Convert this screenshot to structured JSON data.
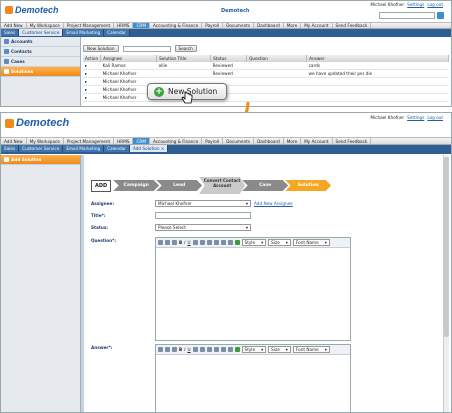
{
  "shot1": {
    "logo": "Demotech",
    "header_center": "Demotech",
    "user_links": [
      "Michael Khofner",
      "Settings",
      "Log out"
    ],
    "search_button": "Search",
    "nav": [
      "Add New",
      "My Workspace",
      "Project Management",
      "HRMS",
      "CRM",
      "Accounting & Finance",
      "Payroll",
      "Documents",
      "Dashboard",
      "More",
      "My Account",
      "Send Feedback"
    ],
    "tabs": [
      "Sales",
      "Customer Service",
      "Email Marketing",
      "Calendar"
    ],
    "sidebar": [
      "Accounts",
      "Contacts",
      "Cases",
      "Solutions"
    ],
    "toolbar": {
      "new_button": "New Solution",
      "search_button": "Search"
    },
    "table": {
      "headers": [
        "Action",
        "Assignee",
        "Solution Title",
        "Status",
        "Question",
        "Answer"
      ],
      "rows": [
        [
          "Kali Ramos",
          "ollie",
          "Reviewed",
          "",
          "cards"
        ],
        [
          "Michael Khofner",
          "",
          "Reviewed",
          "",
          "we have updated their per die"
        ],
        [
          "Michael Khofner",
          "",
          "",
          "",
          ""
        ],
        [
          "Michael Khofner",
          "",
          "",
          "",
          ""
        ],
        [
          "Michael Khofner",
          "",
          "",
          "",
          ""
        ]
      ]
    },
    "callout_label": "New Solution"
  },
  "shot2": {
    "logo": "Demotech",
    "user_links": [
      "Michael Khofner",
      "Settings",
      "Log out"
    ],
    "nav": [
      "Add New",
      "My Workspace",
      "Project Management",
      "HRMS",
      "CRM",
      "Accounting & Finance",
      "Payroll",
      "Documents",
      "Dashboard",
      "More",
      "My Account",
      "Send Feedback"
    ],
    "tabs": [
      "Sales",
      "Customer Service",
      "Email Marketing",
      "Calendar",
      "Add Solution"
    ],
    "sidebar": [
      "Add Solution"
    ],
    "workflow": {
      "add": "ADD",
      "steps": [
        "Campaign",
        "Lead",
        "Convert Contact Account",
        "Case",
        "Solution"
      ]
    },
    "form": {
      "assignee_label": "Assignee:",
      "assignee_value": "Michael Khofner",
      "add_new_assignee": "Add New Assignee",
      "title_label": "Title*:",
      "status_label": "Status:",
      "status_value": "Please Select",
      "question_label": "Question*:",
      "answer_label": "Answer*:",
      "editor_style": "Style",
      "editor_size": "Size",
      "editor_font": "Font Name"
    }
  },
  "colors": {
    "brand": "#1e5fa8",
    "accent": "#f08a1c",
    "tabbar": "#2d5e96"
  }
}
